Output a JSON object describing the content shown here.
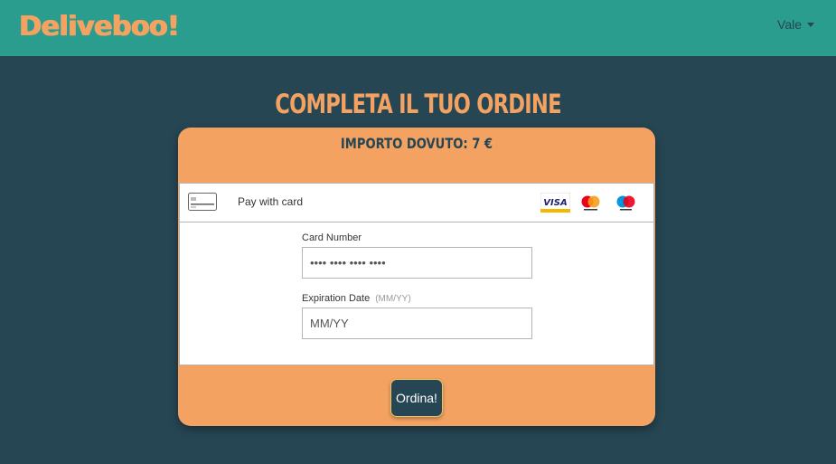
{
  "navbar": {
    "brand": "Deliveboo!",
    "user": "Vale"
  },
  "page": {
    "title": "Completa il tuo ordine"
  },
  "checkout": {
    "amount_label": "Importo dovuto: 7 €",
    "payment_method": "Pay with card",
    "card_brands": [
      "VISA",
      "mastercard",
      "maestro"
    ],
    "card_number_label": "Card Number",
    "card_number_placeholder": "•••• •••• •••• ••••",
    "expiration_label": "Expiration Date",
    "expiration_hint": "(MM/YY)",
    "expiration_placeholder": "MM/YY",
    "submit_label": "Ordina!"
  },
  "colors": {
    "navbar": "#2a9d8f",
    "background": "#264653",
    "accent": "#f4a261"
  }
}
